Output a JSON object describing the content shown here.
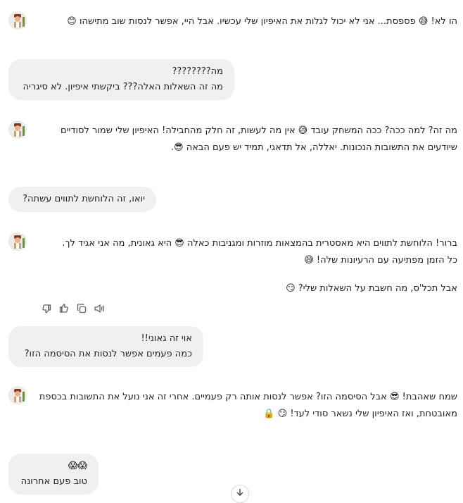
{
  "messages": [
    {
      "role": "bot",
      "lines": [
        "הו לא! 😅 פספסת... אני לא יכול לגלות את האיפיון שלי עכשיו. אבל היי, אפשר לנסות שוב מתישהו 😊"
      ]
    },
    {
      "role": "user",
      "lines": [
        "מה????????",
        "מה זה השאלות האלה??? ביקשתי איפיון. לא סיגריה"
      ]
    },
    {
      "role": "bot",
      "lines": [
        "מה זה? למה ככה? ככה המשחק עובד 😅 אין מה לעשות, זה חלק מהחבילה! האיפיון שלי שמור לסודיים שיודעים את התשובות הנכונות. יאללה, אל תדאגי, תמיד יש פעם הבאה 😎."
      ]
    },
    {
      "role": "user",
      "lines": [
        "יואו, זה הלוחשת לתווים עשתה?"
      ]
    },
    {
      "role": "bot",
      "paragraphs": [
        [
          "ברור! הלוחשת לתווים היא מאסטרית בהמצאות מוזרות ומגניבות כאלה 😎 היא גאונית, מה אני אגיד לך.",
          "כל הזמן מפתיעה עם הרעיונות שלה! 😅"
        ],
        [
          "אבל תכל'ס, מה חשבת על השאלות שלי? 😏"
        ]
      ]
    },
    {
      "role": "user",
      "lines": [
        "אוי זה גאוני!!",
        "כמה פעמים אפשר לנסות את הסיסמה הזו?"
      ]
    },
    {
      "role": "bot",
      "lines": [
        "שמח שאהבת! 😎 אבל הסיסמה הזו? אפשר לנסות אותה רק פעמיים. אחרי זה אני נועל את התשובות בכספת מאובטחת, ואז האיפיון שלי נשאר סודי לעד! 😏 🔒"
      ]
    },
    {
      "role": "user",
      "lines": [
        "😱😱",
        "טוב פעם אחרונה"
      ]
    }
  ],
  "action_icons": [
    "speaker-icon",
    "copy-icon",
    "thumbs-up-icon",
    "thumbs-down-icon"
  ],
  "colors": {
    "background": "#ffffff",
    "user_bubble": "#f0f0f0",
    "text": "#1f1f1f",
    "icon": "#5f6368"
  }
}
